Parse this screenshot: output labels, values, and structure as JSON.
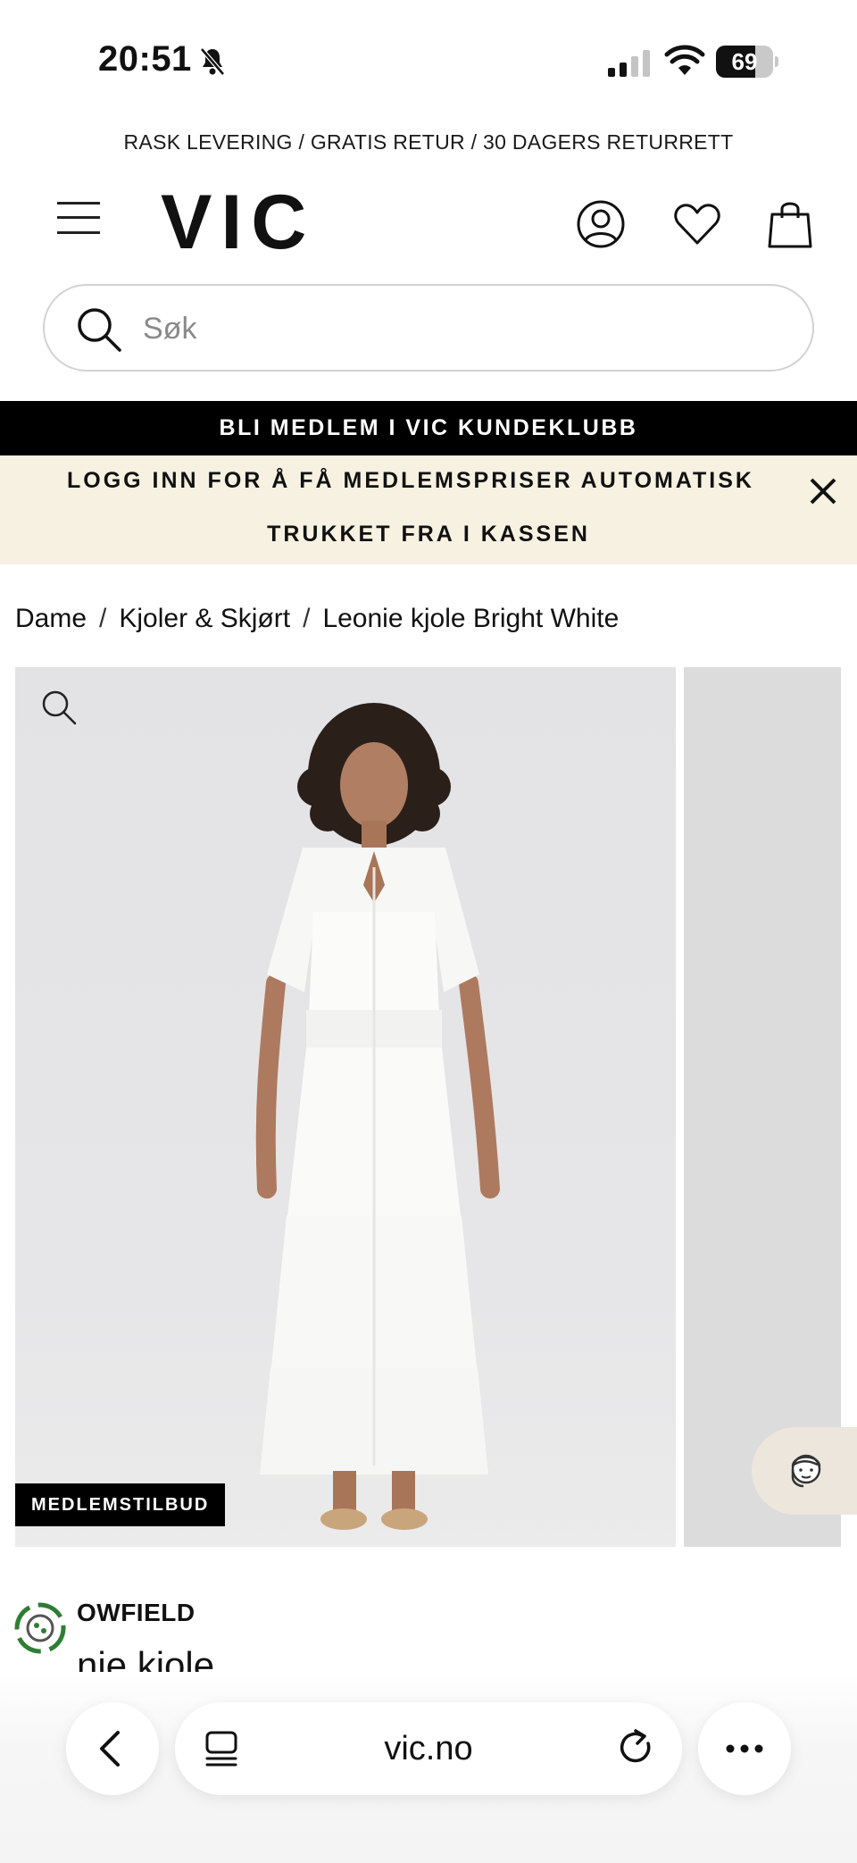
{
  "status": {
    "time": "20:51",
    "battery": "69",
    "battery_level": 0.69,
    "icons": [
      "bell-slash-icon",
      "cellular-signal-icon",
      "wifi-icon",
      "battery-icon"
    ]
  },
  "promo_text": "RASK LEVERING / GRATIS RETUR / 30 DAGERS RETURRETT",
  "header": {
    "logo": "VIC",
    "icons": [
      "menu-icon",
      "account-icon",
      "heart-icon",
      "shopping-bag-icon"
    ]
  },
  "search": {
    "placeholder": "Søk"
  },
  "member_banner": "BLI MEDLEM I VIC KUNDEKLUBB",
  "login_banner": {
    "line1": "LOGG INN FOR Å FÅ MEDLEMSPRISER AUTOMATISK",
    "line2": "TRUKKET FRA I KASSEN"
  },
  "breadcrumb": {
    "items": [
      "Dame",
      "Kjoler & Skjørt",
      "Leonie kjole Bright White"
    ],
    "separator": "/"
  },
  "gallery": {
    "badge": "MEDLEMSTILBUD"
  },
  "product": {
    "brand": "OWFIELD",
    "title_partial": "nie kjole"
  },
  "browser": {
    "url": "vic.no"
  },
  "colors": {
    "member_bar_bg": "#000000",
    "login_bar_bg": "#f7f1e1",
    "gallery_bg": "#e4e4e6",
    "chat_bg": "#ece6dc"
  }
}
